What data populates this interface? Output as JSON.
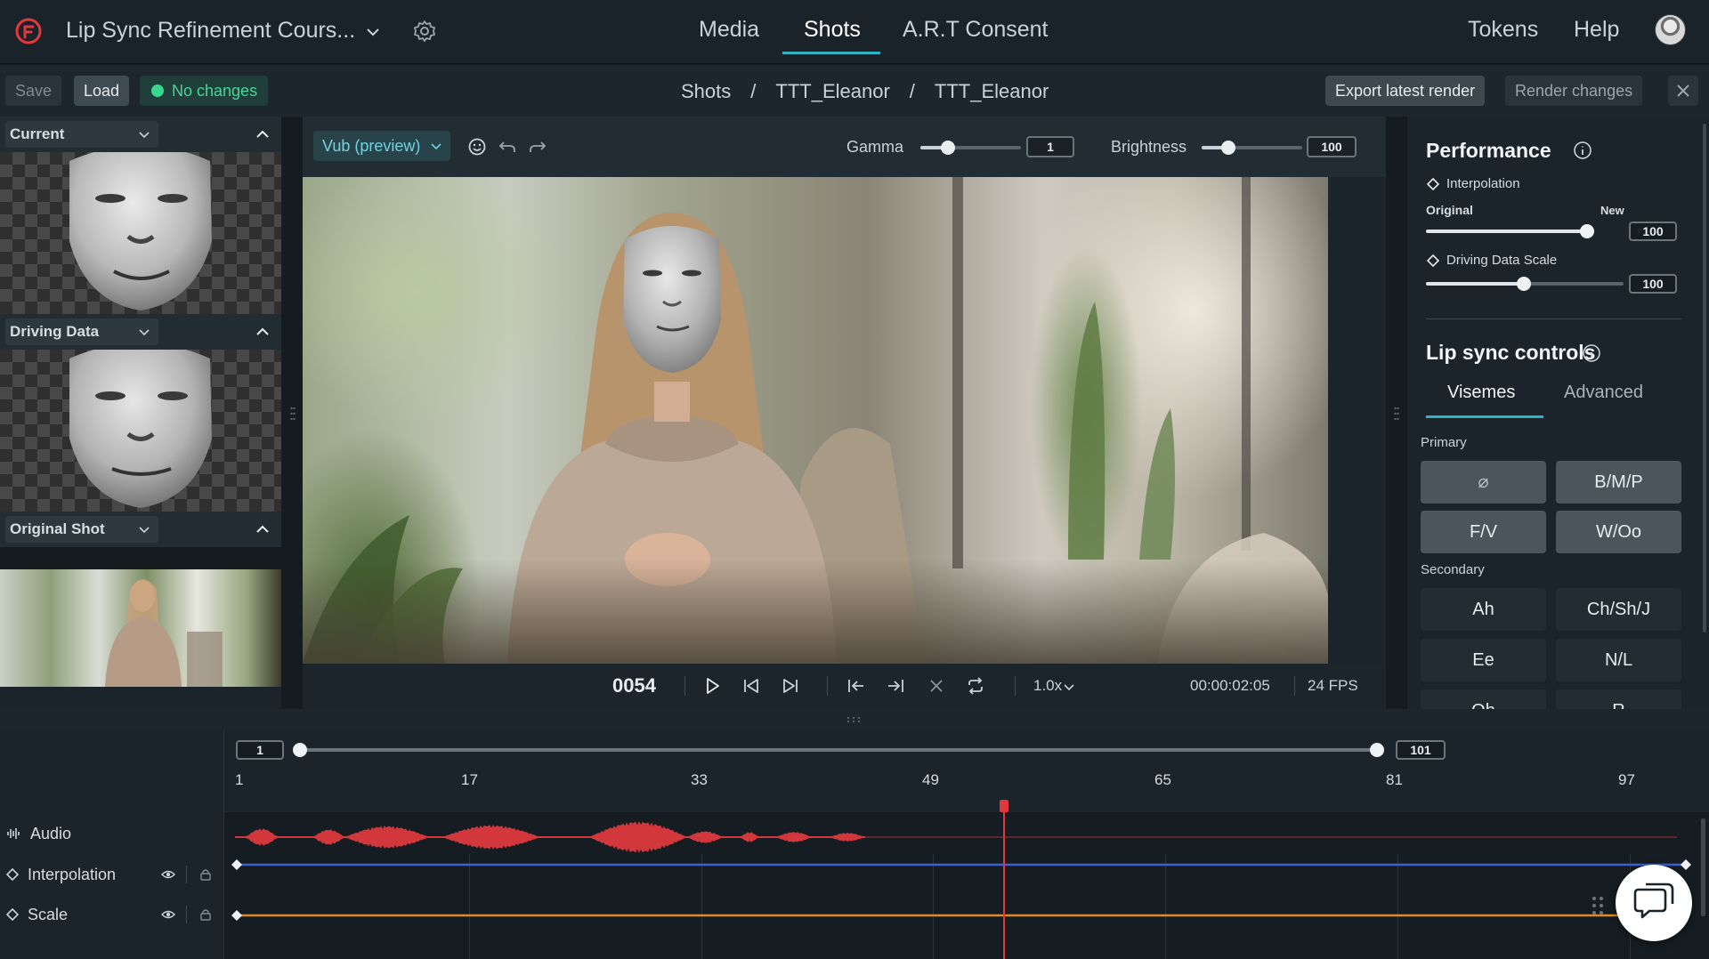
{
  "header": {
    "project_title": "Lip Sync Refinement Cours...",
    "nav": [
      "Media",
      "Shots",
      "A.R.T Consent"
    ],
    "active_nav": "Shots",
    "tokens": "Tokens",
    "help": "Help"
  },
  "toolbar": {
    "save": "Save",
    "load": "Load",
    "status": "No changes",
    "breadcrumb": [
      "Shots",
      "/",
      "TTT_Eleanor",
      "/",
      "TTT_Eleanor"
    ],
    "export": "Export latest render",
    "render": "Render changes"
  },
  "left_panel": {
    "sections": [
      "Current",
      "Driving Data",
      "Original Shot"
    ]
  },
  "preview": {
    "model_select": "Vub (preview)",
    "gamma_label": "Gamma",
    "gamma_value": "1",
    "brightness_label": "Brightness",
    "brightness_value": "100",
    "frame": "0054",
    "speed": "1.0x",
    "timecode": "00:00:02:05",
    "fps": "24 FPS"
  },
  "performance": {
    "title": "Performance",
    "interpolation_label": "Interpolation",
    "original_label": "Original",
    "new_label": "New",
    "interpolation_value": "100",
    "driving_scale_label": "Driving Data Scale",
    "driving_scale_value": "100"
  },
  "lipsync": {
    "title": "Lip sync controls",
    "tabs": [
      "Visemes",
      "Advanced"
    ],
    "primary_label": "Primary",
    "primary": [
      "⌀",
      "B/M/P",
      "F/V",
      "W/Oo"
    ],
    "secondary_label": "Secondary",
    "secondary": [
      "Ah",
      "Ch/Sh/J",
      "Ee",
      "N/L",
      "Oh",
      "R"
    ]
  },
  "timeline": {
    "range_start": "1",
    "range_end": "101",
    "ticks": [
      "1",
      "17",
      "33",
      "49",
      "65",
      "81",
      "97"
    ],
    "tracks": [
      "Audio",
      "Interpolation",
      "Scale"
    ],
    "colors": {
      "audio": "#d1373b",
      "interpolation": "#3e5fd6",
      "scale": "#e08a2b",
      "accent": "#2fb3c4"
    }
  }
}
